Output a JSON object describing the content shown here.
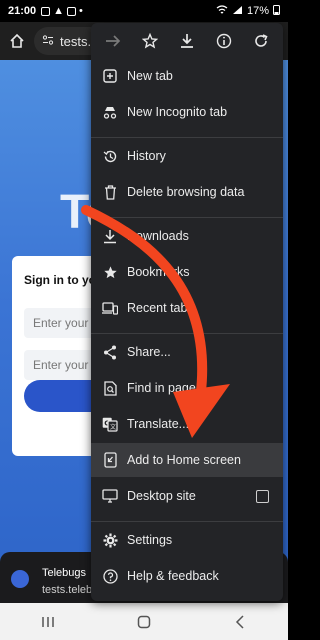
{
  "status_bar": {
    "time": "21:00",
    "battery": "17%"
  },
  "toolbar": {
    "url": "tests."
  },
  "page": {
    "logo": "Te",
    "signin_title": "Sign in to yo",
    "input1_placeholder": "Enter your",
    "input2_placeholder": "Enter your"
  },
  "banner": {
    "title": "Telebugs",
    "url": "tests.telebug"
  },
  "menu": {
    "items": [
      {
        "label": "New tab",
        "icon": "new-tab-icon"
      },
      {
        "label": "New Incognito tab",
        "icon": "incognito-icon"
      },
      {
        "label": "History",
        "icon": "history-icon"
      },
      {
        "label": "Delete browsing data",
        "icon": "trash-icon"
      },
      {
        "label": "Downloads",
        "icon": "downloads-icon"
      },
      {
        "label": "Bookmarks",
        "icon": "star-icon"
      },
      {
        "label": "Recent tabs",
        "icon": "devices-icon"
      },
      {
        "label": "Share...",
        "icon": "share-icon"
      },
      {
        "label": "Find in page",
        "icon": "find-icon"
      },
      {
        "label": "Translate...",
        "icon": "translate-icon"
      },
      {
        "label": "Add to Home screen",
        "icon": "add-to-home-icon"
      },
      {
        "label": "Desktop site",
        "icon": "desktop-icon"
      },
      {
        "label": "Settings",
        "icon": "settings-icon"
      },
      {
        "label": "Help & feedback",
        "icon": "help-icon"
      }
    ]
  },
  "colors": {
    "menu_bg": "#232427",
    "arrow": "#f2451f",
    "page_blue": "#3b74d4"
  }
}
